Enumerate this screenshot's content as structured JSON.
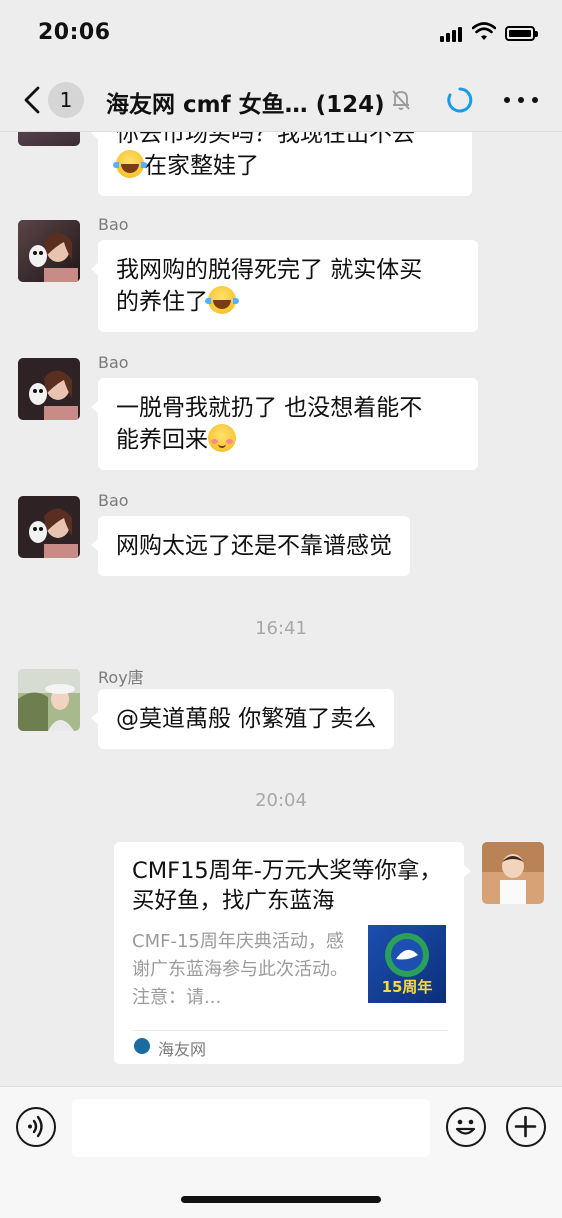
{
  "status_bar": {
    "time": "20:06"
  },
  "nav": {
    "back_badge": "1",
    "title": "海友网 cmf 女鱼… (124)"
  },
  "messages": [
    {
      "type": "bubble",
      "sender": "",
      "text": "你去市场买吗？我现在出不去",
      "text2": "在家整娃了",
      "emoji": "laugh-cry"
    },
    {
      "type": "bubble",
      "sender": "Bao",
      "text": "我网购的脱得死完了 就实体买",
      "text2": "的养住了",
      "emoji": "laugh-cry"
    },
    {
      "type": "bubble",
      "sender": "Bao",
      "text": "一脱骨我就扔了 也没想着能不",
      "text2": "能养回来",
      "emoji": "shy"
    },
    {
      "type": "bubble",
      "sender": "Bao",
      "text": "网购太远了还是不靠谱感觉"
    },
    {
      "type": "time",
      "text": "16:41"
    },
    {
      "type": "bubble",
      "sender": "Roy唐",
      "text": "@莫道萬般 你繁殖了卖么"
    },
    {
      "type": "time",
      "text": "20:04"
    }
  ],
  "card": {
    "title": "CMF15周年-万元大奖等你拿，买好鱼，找广东蓝海",
    "description": "CMF-15周年庆典活动，感谢广东蓝海参与此次活动。注意：请...",
    "thumbnail_text": "15周年",
    "source": "海友网"
  },
  "input": {
    "placeholder": ""
  },
  "colors": {
    "background": "#ededed",
    "bubble": "#ffffff",
    "loading_icon": "#1a9bea"
  }
}
